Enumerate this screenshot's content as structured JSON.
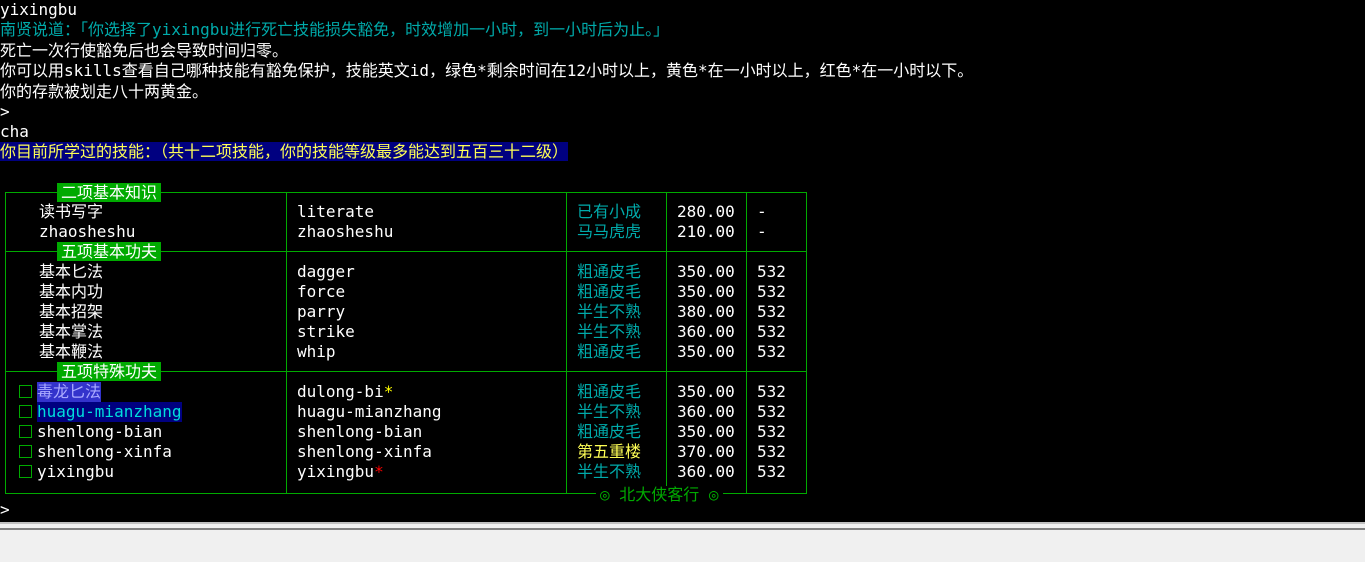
{
  "console": {
    "cmd1": "yixingbu",
    "npc_say": "南贤说道：「你选择了yixingbu进行死亡技能损失豁免，时效增加一小时，到一小时后为止。」",
    "info1": "死亡一次行使豁免后也会导致时间归零。",
    "info2": "你可以用skills查看自己哪种技能有豁免保护，技能英文id，绿色*剩余时间在12小时以上，黄色*在一小时以上，红色*在一小时以下。",
    "info3": "你的存款被划走八十两黄金。",
    "prompt": ">",
    "cmd2": "cha",
    "skills_header": "你目前所学过的技能：（共十二项技能，你的技能等级最多能达到五百三十二级）",
    "prompt_end": ">"
  },
  "table": {
    "section_basic_knowledge": "二项基本知识",
    "section_basic_skills": "五项基本功夫",
    "section_special_skills": "五项特殊功夫",
    "footer": "◎ 北大侠客行 ◎",
    "star": "*",
    "knowledge": [
      {
        "name": "读书写字",
        "id": "literate",
        "level": "已有小成",
        "points": "280.00",
        "limit": "-"
      },
      {
        "name": "zhaosheshu",
        "id": "zhaosheshu",
        "level": "马马虎虎",
        "points": "210.00",
        "limit": "-"
      }
    ],
    "basic": [
      {
        "name": "基本匕法",
        "id": "dagger",
        "level": "粗通皮毛",
        "points": "350.00",
        "limit": "532"
      },
      {
        "name": "基本内功",
        "id": "force",
        "level": "粗通皮毛",
        "points": "350.00",
        "limit": "532"
      },
      {
        "name": "基本招架",
        "id": "parry",
        "level": "半生不熟",
        "points": "380.00",
        "limit": "532"
      },
      {
        "name": "基本掌法",
        "id": "strike",
        "level": "半生不熟",
        "points": "360.00",
        "limit": "532"
      },
      {
        "name": "基本鞭法",
        "id": "whip",
        "level": "粗通皮毛",
        "points": "350.00",
        "limit": "532"
      }
    ],
    "special": [
      {
        "name": "毒龙匕法",
        "id": "dulong-bi",
        "level": "粗通皮毛",
        "points": "350.00",
        "limit": "532"
      },
      {
        "name": "huagu-mianzhang",
        "id": "huagu-mianzhang",
        "level": "半生不熟",
        "points": "360.00",
        "limit": "532"
      },
      {
        "name": "shenlong-bian",
        "id": "shenlong-bian",
        "level": "粗通皮毛",
        "points": "350.00",
        "limit": "532"
      },
      {
        "name": "shenlong-xinfa",
        "id": "shenlong-xinfa",
        "level": "第五重楼",
        "points": "370.00",
        "limit": "532"
      },
      {
        "name": "yixingbu",
        "id": "yixingbu",
        "level": "半生不熟",
        "points": "360.00",
        "limit": "532"
      }
    ]
  },
  "colors": {
    "border": "#00aa00",
    "level_text": "#00aaaa",
    "highlight_level": "#ffff55",
    "star_yellow": "#ffff00",
    "star_red": "#ff0000",
    "header_bg": "#000080"
  }
}
